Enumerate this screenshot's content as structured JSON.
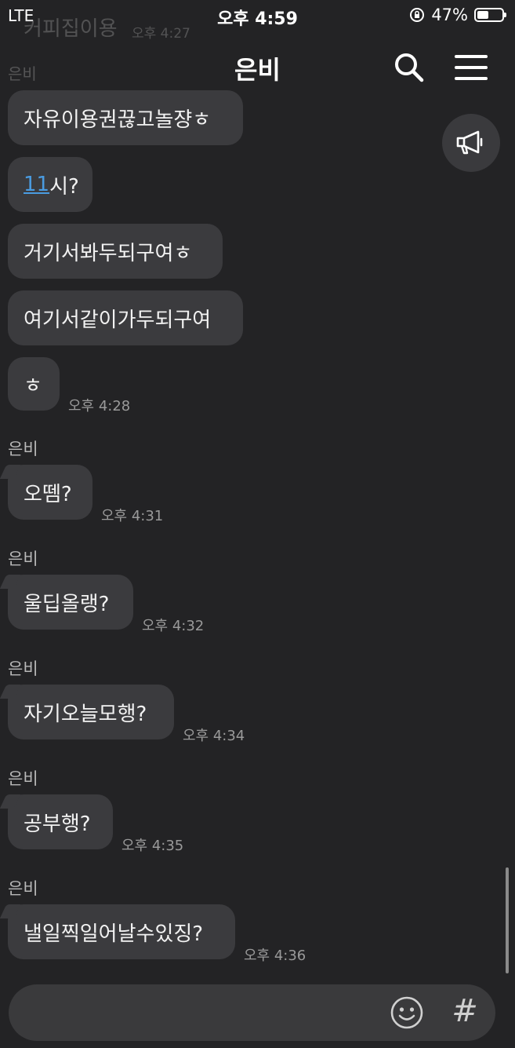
{
  "status_bar": {
    "carrier": "LTE",
    "time": "오후 4:59",
    "battery": "47%",
    "battery_level": 0.47
  },
  "ghost": {
    "text": "커피집이용",
    "time": "오후 4:27",
    "sender": "은비"
  },
  "header": {
    "title": "은비",
    "search_icon": "search-icon",
    "menu_icon": "hamburger-menu-icon"
  },
  "notice_icon": "megaphone-icon",
  "messages": [
    {
      "text": "자유이용권끊고놀쟝ㅎ"
    },
    {
      "link": "11",
      "text": "시?"
    },
    {
      "text": "거기서봐두되구여ㅎ"
    },
    {
      "text": "여기서같이가두되구여"
    },
    {
      "text": "ㅎ",
      "time": "오후 4:28"
    },
    {
      "sender": "은비",
      "text": "오뗌?",
      "time": "오후 4:31"
    },
    {
      "sender": "은비",
      "text": "울딥올랭?",
      "time": "오후 4:32"
    },
    {
      "sender": "은비",
      "text": "자기오늘모행?",
      "time": "오후 4:34"
    },
    {
      "sender": "은비",
      "text": "공부행?",
      "time": "오후 4:35"
    },
    {
      "sender": "은비",
      "text": "낼일찍일어날수있징?",
      "time": "오후 4:36"
    }
  ],
  "composer": {
    "placeholder": "",
    "emoji_icon": "emoji-icon",
    "hash_label": "#"
  }
}
